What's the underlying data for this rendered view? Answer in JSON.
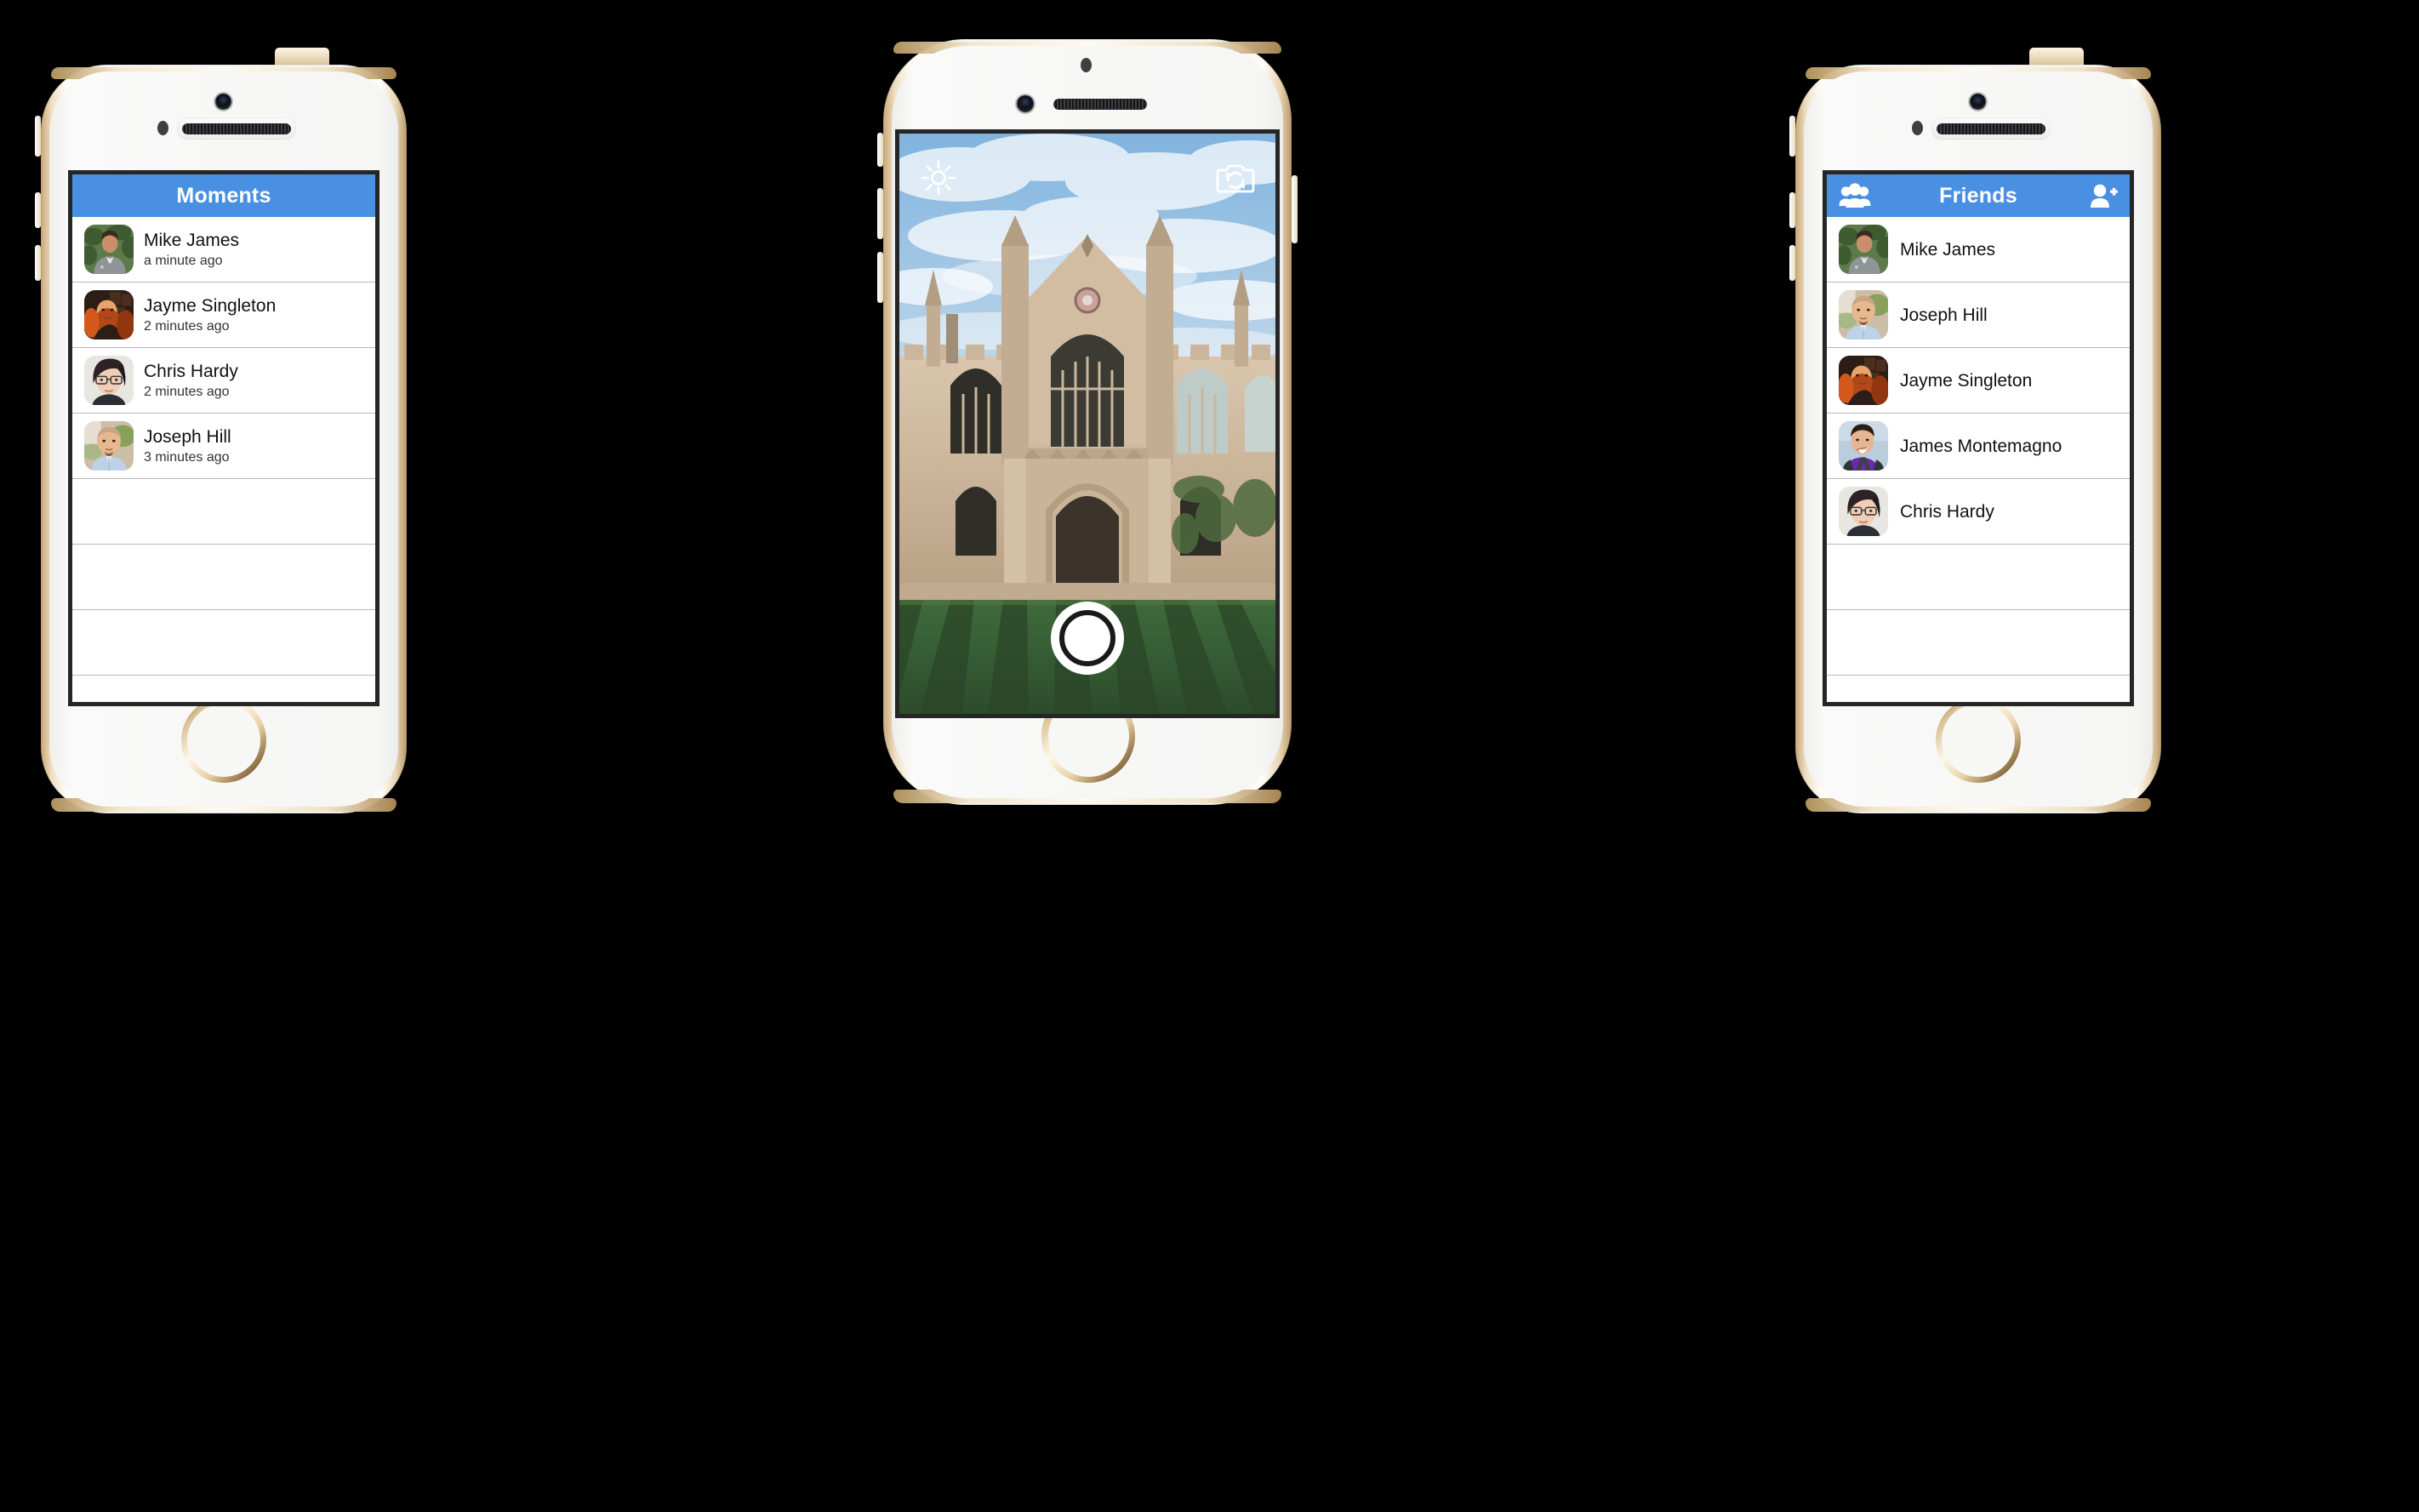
{
  "scene": {
    "background_color": "#000000",
    "accent_blue": "#4a90e2",
    "device_count": 3
  },
  "phones": [
    {
      "id": "left",
      "model": "iphone-5s-gold",
      "app_screen": "moments-list"
    },
    {
      "id": "center",
      "model": "iphone-6-gold",
      "app_screen": "camera-capture"
    },
    {
      "id": "right",
      "model": "iphone-5s-gold",
      "app_screen": "friends-list"
    }
  ],
  "moments_screen": {
    "navbar": {
      "title": "Moments"
    },
    "rows": [
      {
        "name": "Mike James",
        "time": "a minute ago",
        "avatar": "mike-james-avatar"
      },
      {
        "name": "Jayme Singleton",
        "time": "2 minutes ago",
        "avatar": "jayme-singleton-avatar"
      },
      {
        "name": "Chris Hardy",
        "time": "2 minutes ago",
        "avatar": "chris-hardy-avatar"
      },
      {
        "name": "Joseph Hill",
        "time": "3 minutes ago",
        "avatar": "joseph-hill-avatar"
      }
    ],
    "empty_row_count": 3
  },
  "camera_screen": {
    "brightness_icon": "sun-icon",
    "flip_camera_icon": "camera-flip-icon",
    "shutter_button": "shutter-button",
    "photo_subject": "gothic-chapel-with-striped-lawn"
  },
  "friends_screen": {
    "navbar": {
      "title": "Friends",
      "left_icon": "group-people-icon",
      "right_icon": "add-friend-icon"
    },
    "rows": [
      {
        "name": "Mike James",
        "avatar": "mike-james-avatar"
      },
      {
        "name": "Joseph Hill",
        "avatar": "joseph-hill-avatar"
      },
      {
        "name": "Jayme Singleton",
        "avatar": "jayme-singleton-avatar"
      },
      {
        "name": "James Montemagno",
        "avatar": "james-montemagno-avatar"
      },
      {
        "name": "Chris Hardy",
        "avatar": "chris-hardy-avatar"
      }
    ],
    "empty_row_count": 3
  }
}
